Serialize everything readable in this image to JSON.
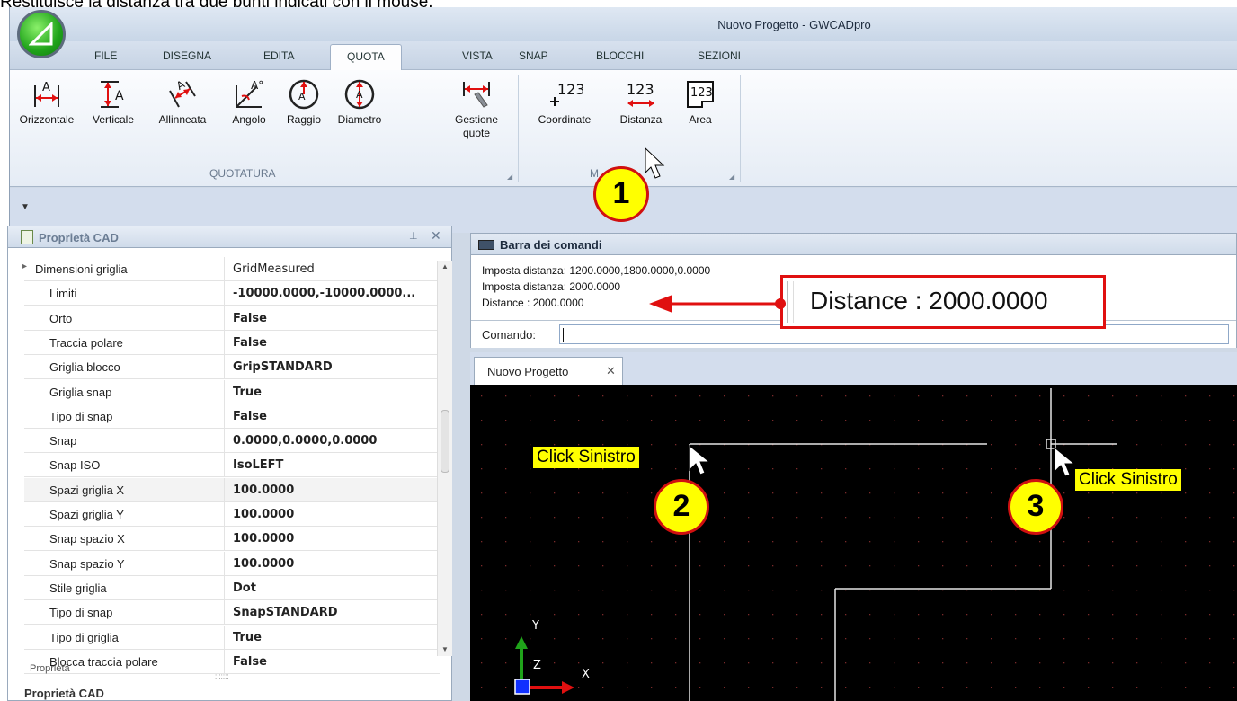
{
  "caption": "Restituisce la distanza tra due punti indicati con il mouse.",
  "window": {
    "title": "Nuovo Progetto - GWCADpro"
  },
  "menu_tabs": [
    "FILE",
    "DISEGNA",
    "EDITA",
    "QUOTA",
    "VISTA",
    "SNAP",
    "BLOCCHI",
    "SEZIONI"
  ],
  "active_tab": "QUOTA",
  "ribbon": {
    "groups": [
      {
        "label": "QUOTATURA"
      },
      {
        "label": "M"
      }
    ],
    "buttons": [
      {
        "label": "Orizzontale",
        "icon": "dim-horizontal-icon"
      },
      {
        "label": "Verticale",
        "icon": "dim-vertical-icon"
      },
      {
        "label": "Allinneata",
        "icon": "dim-aligned-icon"
      },
      {
        "label": "Angolo",
        "icon": "dim-angle-icon"
      },
      {
        "label": "Raggio",
        "icon": "dim-radius-icon"
      },
      {
        "label": "Diametro",
        "icon": "dim-diameter-icon"
      },
      {
        "label": "Gestione quote",
        "icon": "dim-manage-icon"
      },
      {
        "label": "Coordinate",
        "icon": "coordinate-icon"
      },
      {
        "label": "Distanza",
        "icon": "distance-icon"
      },
      {
        "label": "Area",
        "icon": "area-icon"
      }
    ]
  },
  "properties_panel": {
    "title": "Proprietà CAD",
    "rows": [
      {
        "name": "Dimensioni griglia",
        "value": "GridMeasured",
        "bold": false
      },
      {
        "name": "Limiti",
        "value": "-10000.0000,-10000.0000...",
        "bold": true
      },
      {
        "name": "Orto",
        "value": "False",
        "bold": true
      },
      {
        "name": "Traccia polare",
        "value": "False",
        "bold": true
      },
      {
        "name": "Griglia blocco",
        "value": "GripSTANDARD",
        "bold": true
      },
      {
        "name": "Griglia snap",
        "value": "True",
        "bold": true
      },
      {
        "name": "Tipo di snap",
        "value": "False",
        "bold": true
      },
      {
        "name": "Snap",
        "value": "0.0000,0.0000,0.0000",
        "bold": true
      },
      {
        "name": "Snap ISO",
        "value": "IsoLEFT",
        "bold": true
      },
      {
        "name": "Spazi griglia X",
        "value": "100.0000",
        "bold": true
      },
      {
        "name": "Spazi griglia Y",
        "value": "100.0000",
        "bold": true
      },
      {
        "name": "Snap spazio X",
        "value": "100.0000",
        "bold": true
      },
      {
        "name": "Snap spazio Y",
        "value": "100.0000",
        "bold": true
      },
      {
        "name": "Stile griglia",
        "value": "Dot",
        "bold": true
      },
      {
        "name": "Tipo di snap",
        "value": "SnapSTANDARD",
        "bold": true
      },
      {
        "name": "Tipo di griglia",
        "value": "True",
        "bold": true
      },
      {
        "name": "Blocca traccia polare",
        "value": "False",
        "bold": true
      }
    ],
    "truncated_label": "Proprietà",
    "bottom_label": "Proprietà CAD"
  },
  "command_bar": {
    "title": "Barra dei comandi",
    "lines": [
      "Imposta distanza: 1200.0000,1800.0000,0.0000",
      "Imposta distanza: 2000.0000",
      "Distance :  2000.0000"
    ],
    "prompt_label": "Comando:",
    "input_value": ""
  },
  "callout": {
    "text": "Distance :  2000.0000"
  },
  "document_tab": {
    "label": "Nuovo Progetto"
  },
  "canvas": {
    "axis_x": "X",
    "axis_y": "Y",
    "axis_z": "Z"
  },
  "annotations": {
    "step1": "1",
    "step2": "2",
    "step3": "3",
    "click_left_1": "Click Sinistro",
    "click_left_2": "Click Sinistro"
  },
  "colors": {
    "accent_red": "#e01010",
    "highlight_yellow": "#ffff00",
    "canvas_bg": "#000000"
  }
}
